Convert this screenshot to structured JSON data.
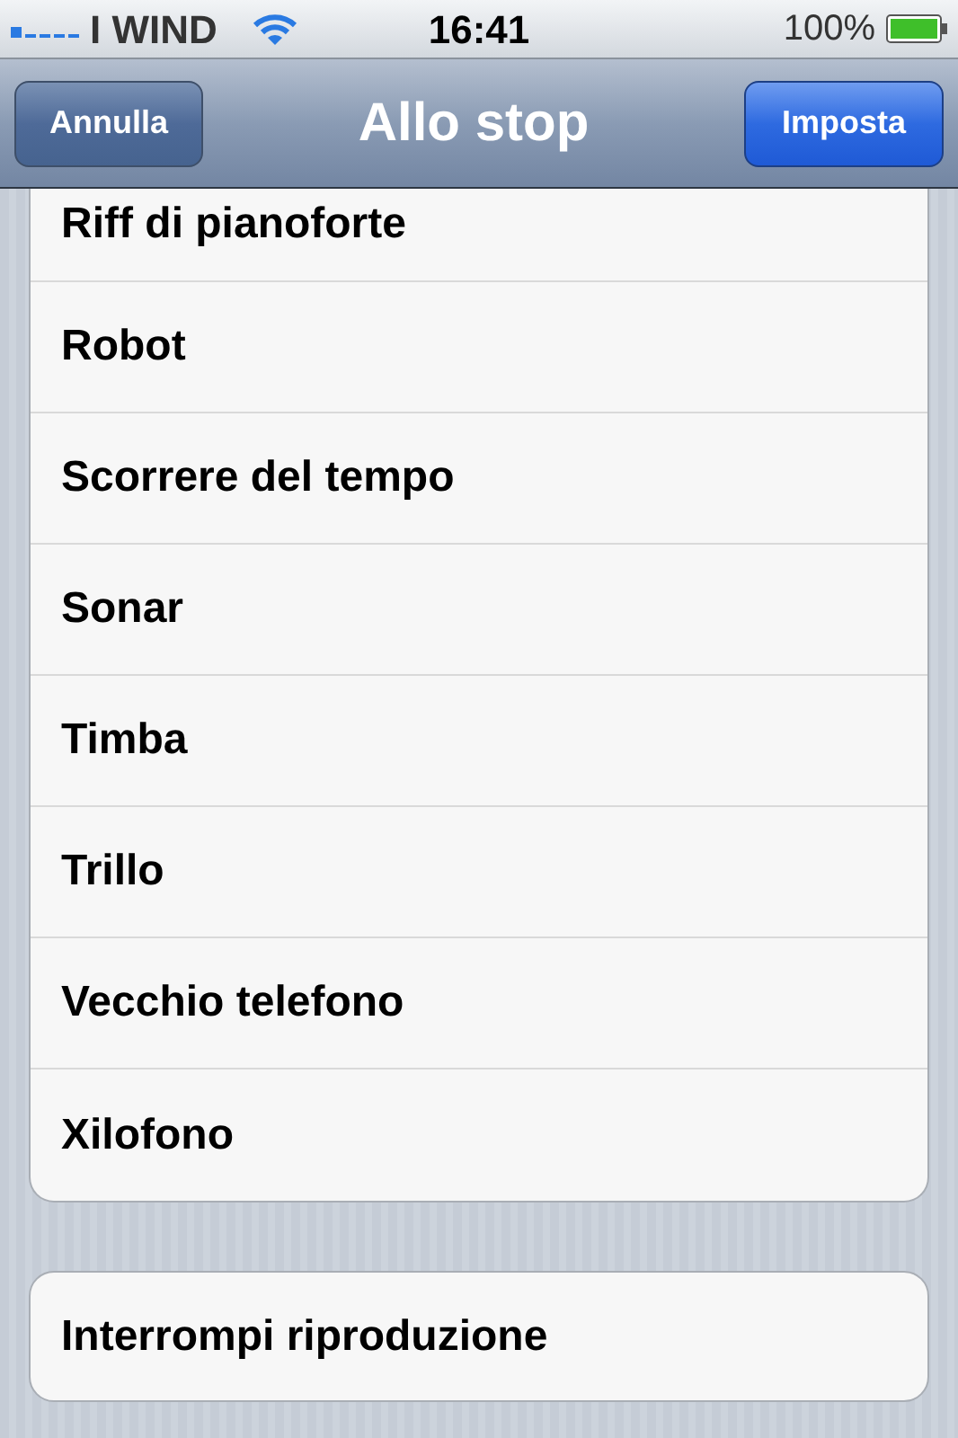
{
  "status_bar": {
    "carrier": "I WIND",
    "time": "16:41",
    "battery": "100%"
  },
  "nav_bar": {
    "title": "Allo stop",
    "left_button": "Annulla",
    "right_button": "Imposta"
  },
  "sounds": [
    {
      "label": "Riff di pianoforte"
    },
    {
      "label": "Robot"
    },
    {
      "label": "Scorrere del tempo"
    },
    {
      "label": "Sonar"
    },
    {
      "label": "Timba"
    },
    {
      "label": "Trillo"
    },
    {
      "label": "Vecchio telefono"
    },
    {
      "label": "Xilofono"
    }
  ],
  "stop_option": {
    "label": "Interrompi riproduzione"
  }
}
